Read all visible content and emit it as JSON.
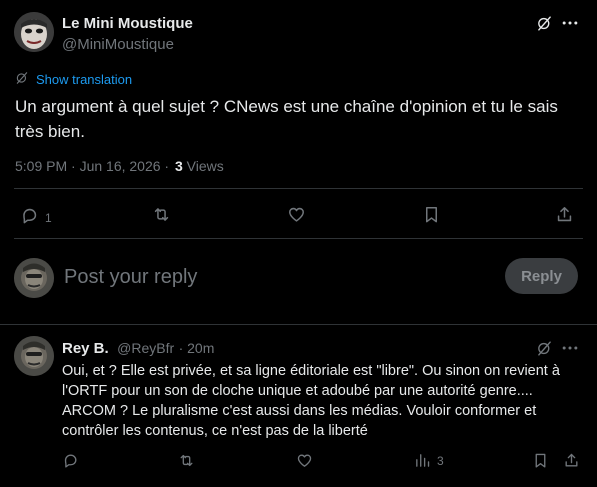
{
  "main_tweet": {
    "author_name": "Le Mini Moustique",
    "author_handle": "@MiniMoustique",
    "translate_label": "Show translation",
    "text_line1": "Un argument à quel sujet ? CNews est une chaîne d'opinion et tu le sais",
    "text_line2": "très bien.",
    "timestamp": "5:09 PM · Jun 16, 2026 ·",
    "views_count": "3",
    "views_label": "Views",
    "reply_count": "1"
  },
  "composer": {
    "placeholder": "Post your reply",
    "button_label": "Reply"
  },
  "reply_tweet": {
    "author_name": "Rey B.",
    "author_handle": "@ReyBfr",
    "time": "· 20m",
    "text_line1": "Oui, et ? Elle est privée, et sa ligne éditoriale est \"libre\". Ou sinon on revient à",
    "text_line2": "l'ORTF pour un son de cloche unique et adoubé par une autorité genre....",
    "text_line3": "ARCOM ? Le pluralisme c'est aussi dans les médias. Vouloir conformer et",
    "text_line4": "contrôler les contenus, ce n'est pas de la liberté",
    "views_count": "3"
  },
  "colors": {
    "background": "#000000",
    "text": "#e7e9ea",
    "muted": "#71767b",
    "link": "#1d9bf0",
    "divider": "#2f3336",
    "reply_button": "#3a3d40"
  }
}
